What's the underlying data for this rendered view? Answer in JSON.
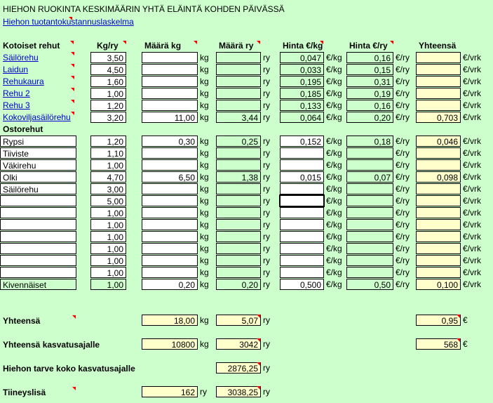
{
  "title": "HIEHON RUOKINTA KESKIMÄÄRIN YHTÄ ELÄINTÄ KOHDEN PÄIVÄSSÄ",
  "cost_link": "Hiehon tuotantokustannuslaskelma",
  "headers": {
    "feeds": "Kotoiset rehut",
    "kg_ry": "Kg/ry",
    "maara_kg": "Määrä kg",
    "maara_ry": "Määrä ry",
    "hinta_kg": "Hinta €/kg",
    "hinta_ry": "Hinta €/ry",
    "yhteensa": "Yhteensä"
  },
  "purchased_label": "Ostorehut",
  "units": {
    "kg": "kg",
    "ry": "ry",
    "eur_kg": "€/kg",
    "eur_ry": "€/ry",
    "eur_vrk": "€/vrk",
    "eur": "€"
  },
  "rows": [
    {
      "name": "Säilörehu",
      "link": true,
      "kgry": "3,50",
      "mkg": "",
      "mry": "",
      "hkg": "0,047",
      "hry": "0,16",
      "yht": ""
    },
    {
      "name": "Laidun",
      "link": true,
      "kgry": "4,50",
      "mkg": "",
      "mry": "",
      "hkg": "0,033",
      "hry": "0,15",
      "yht": ""
    },
    {
      "name": "Rehukaura",
      "link": true,
      "kgry": "1,60",
      "mkg": "",
      "mry": "",
      "hkg": "0,195",
      "hry": "0,31",
      "yht": ""
    },
    {
      "name": "Rehu 2",
      "link": true,
      "kgry": "1,00",
      "mkg": "",
      "mry": "",
      "hkg": "0,185",
      "hry": "0,19",
      "yht": ""
    },
    {
      "name": "Rehu 3",
      "link": true,
      "kgry": "1,20",
      "mkg": "",
      "mry": "",
      "hkg": "0,133",
      "hry": "0,16",
      "yht": ""
    },
    {
      "name": "Kokoviljasäilörehu",
      "link": true,
      "kgry": "3,20",
      "mkg": "11,00",
      "mry": "3,44",
      "hkg": "0,064",
      "hry": "0,20",
      "yht": "0,703"
    },
    {
      "name": "Rypsi",
      "link": false,
      "kgry": "1,20",
      "mkg": "0,30",
      "mry": "0,25",
      "hkg": "0,152",
      "hry": "0,18",
      "yht": "0,046"
    },
    {
      "name": "Tiiviste",
      "link": false,
      "kgry": "1,10",
      "mkg": "",
      "mry": "",
      "hkg": "",
      "hry": "",
      "yht": ""
    },
    {
      "name": "Väkirehu",
      "link": false,
      "kgry": "1,00",
      "mkg": "",
      "mry": "",
      "hkg": "",
      "hry": "",
      "yht": ""
    },
    {
      "name": "Olki",
      "link": false,
      "kgry": "4,70",
      "mkg": "6,50",
      "mry": "1,38",
      "hkg": "0,015",
      "hry": "0,07",
      "yht": "0,098"
    },
    {
      "name": "Säilörehu",
      "link": false,
      "kgry": "3,00",
      "mkg": "",
      "mry": "",
      "hkg": "",
      "hry": "",
      "yht": ""
    },
    {
      "name": "",
      "link": false,
      "kgry": "5,00",
      "mkg": "",
      "mry": "",
      "hkg": "",
      "hry": "",
      "yht": ""
    },
    {
      "name": "",
      "link": false,
      "kgry": "1,00",
      "mkg": "",
      "mry": "",
      "hkg": "",
      "hry": "",
      "yht": ""
    },
    {
      "name": "",
      "link": false,
      "kgry": "1,00",
      "mkg": "",
      "mry": "",
      "hkg": "",
      "hry": "",
      "yht": ""
    },
    {
      "name": "",
      "link": false,
      "kgry": "1,00",
      "mkg": "",
      "mry": "",
      "hkg": "",
      "hry": "",
      "yht": ""
    },
    {
      "name": "",
      "link": false,
      "kgry": "1,00",
      "mkg": "",
      "mry": "",
      "hkg": "",
      "hry": "",
      "yht": ""
    },
    {
      "name": "",
      "link": false,
      "kgry": "1,00",
      "mkg": "",
      "mry": "",
      "hkg": "",
      "hry": "",
      "yht": ""
    },
    {
      "name": "",
      "link": false,
      "kgry": "1,00",
      "mkg": "",
      "mry": "",
      "hkg": "",
      "hry": "",
      "yht": ""
    },
    {
      "name": "Kivennäiset",
      "link": false,
      "kgry": "1,00",
      "mkg": "0,20",
      "mry": "0,20",
      "hkg": "0,500",
      "hry": "0,50",
      "yht": "0,100"
    }
  ],
  "totals": {
    "yhteensa_label": "Yhteensä",
    "yhteensa_kg": "18,00",
    "yhteensa_ry": "5,07",
    "yhteensa_eur": "0,95",
    "kasvatus_label": "Yhteensä kasvatusajalle",
    "kasvatus_kg": "10800",
    "kasvatus_ry": "3042",
    "kasvatus_eur": "568",
    "tarve_label": "Hiehon tarve koko kasvatusajalle",
    "tarve_ry": "2876,25",
    "tiineys_label": "Tiineyslisä",
    "tiineys_1": "162",
    "tiineys_2": "3038,25"
  }
}
